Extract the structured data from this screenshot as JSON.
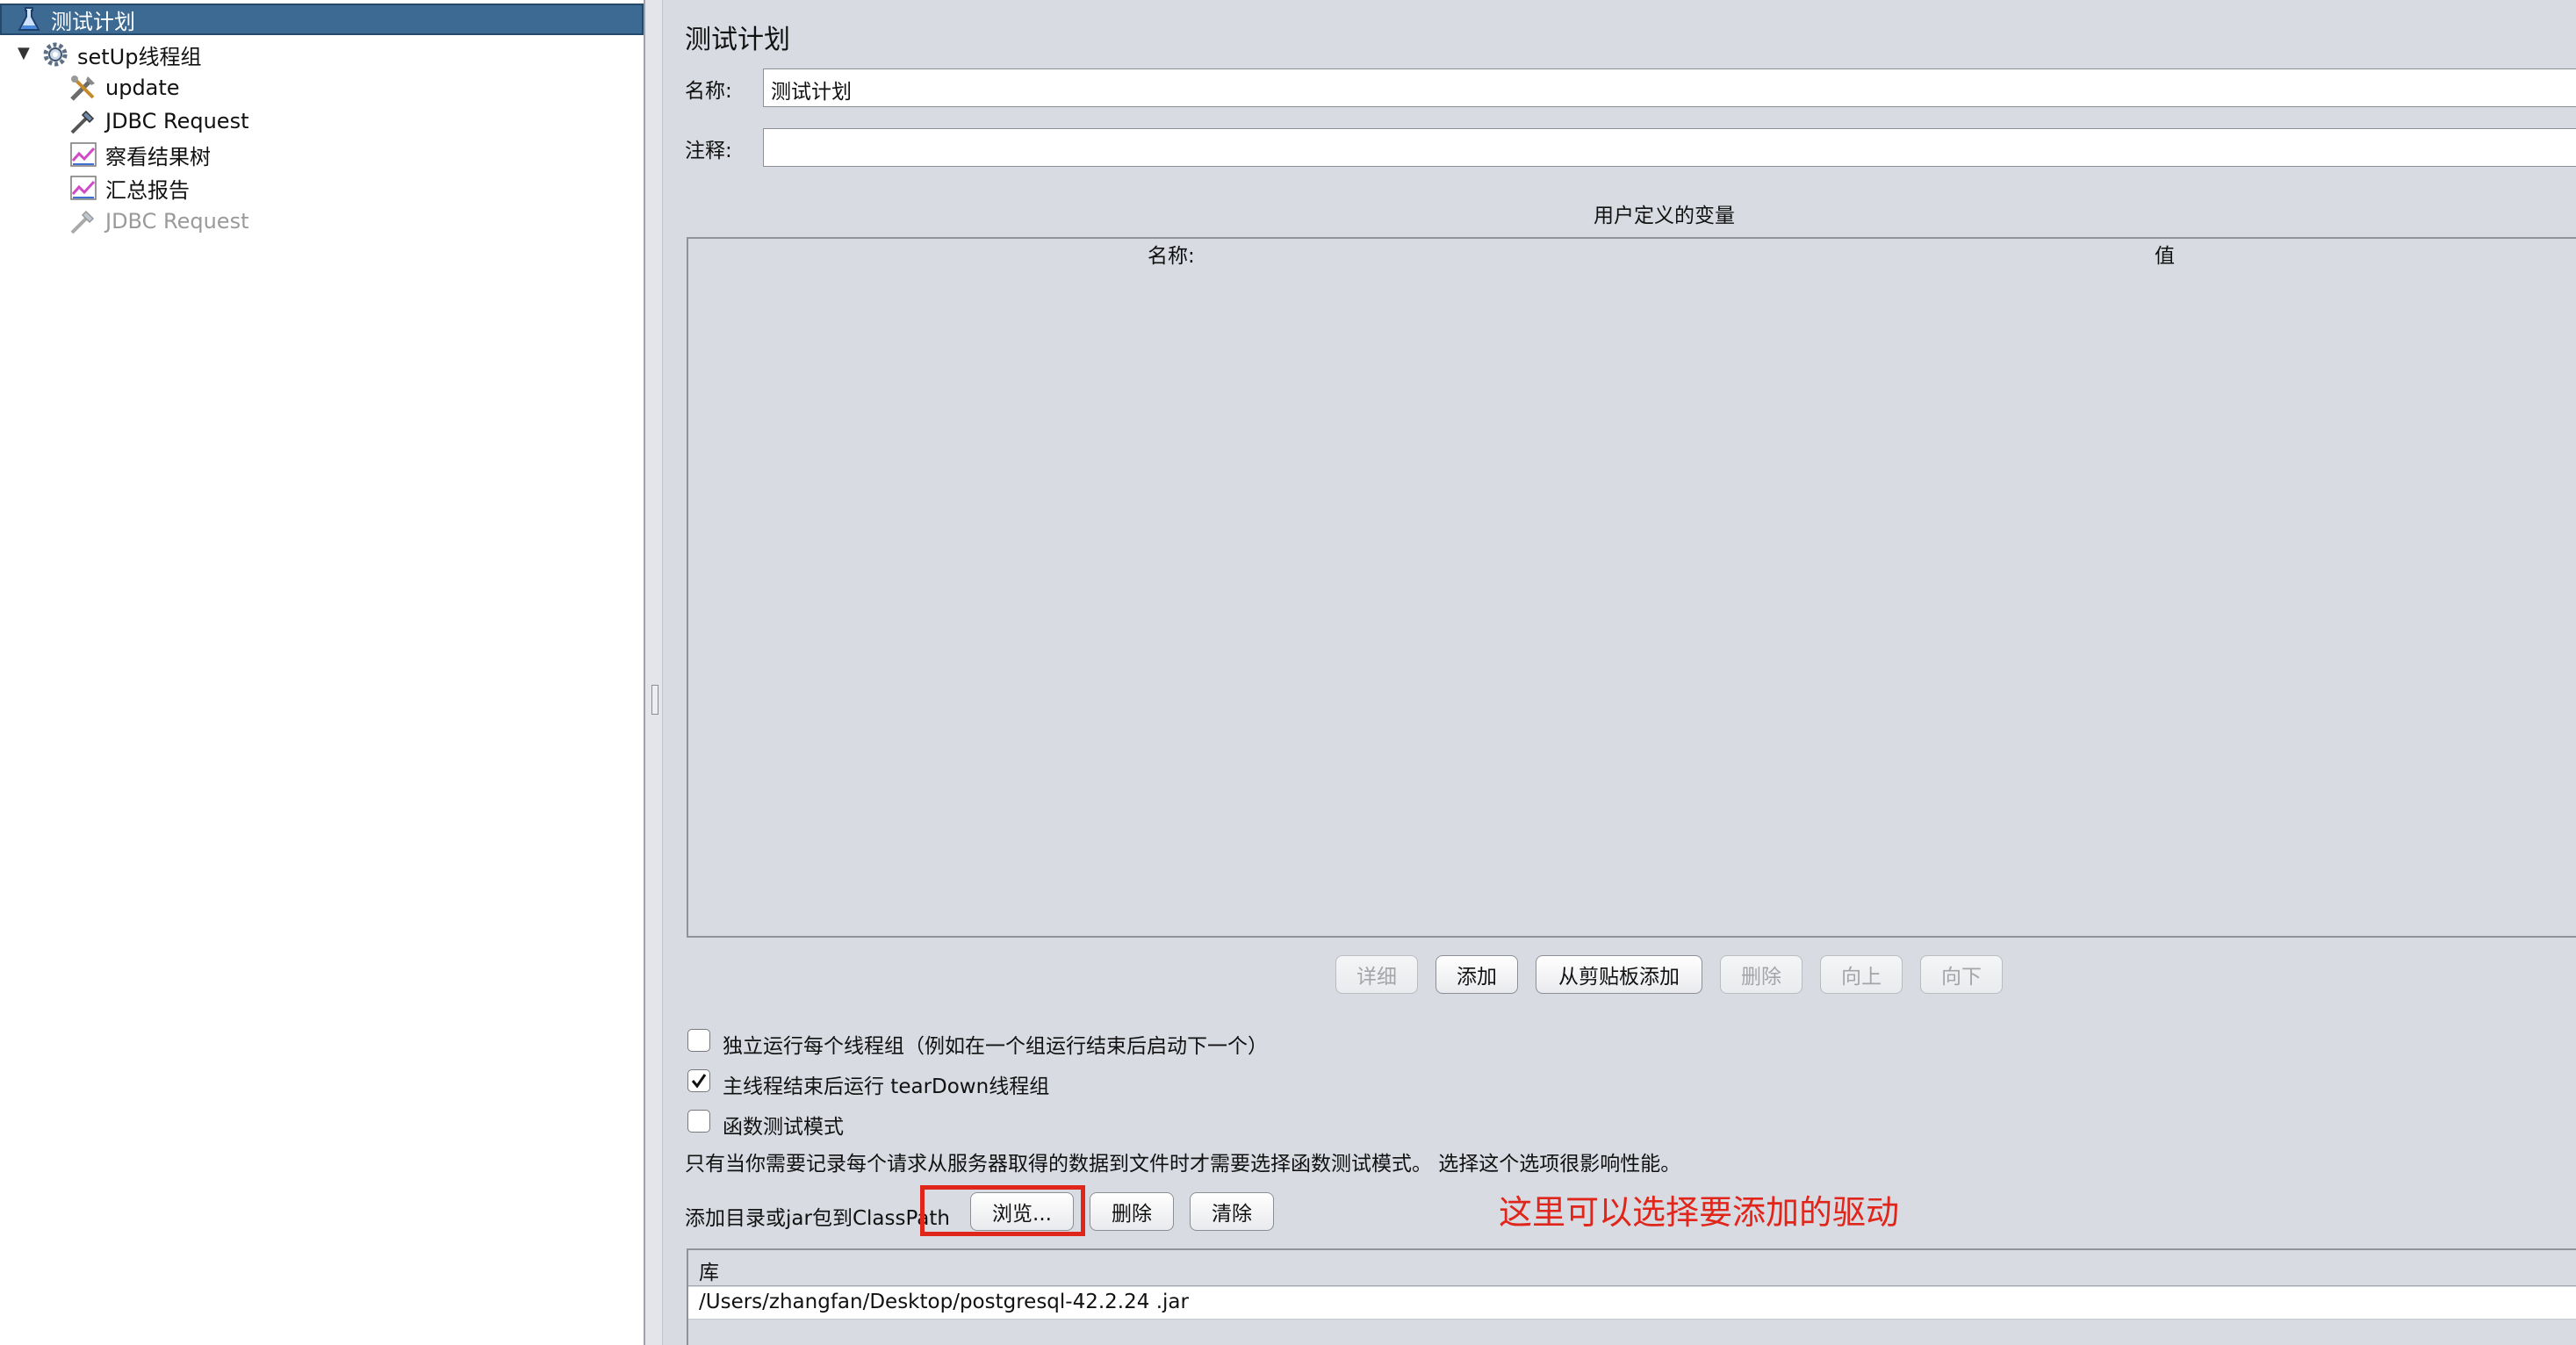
{
  "tree": {
    "root": "测试计划",
    "group": "setUp线程组",
    "items": [
      "update",
      "JDBC Request",
      "察看结果树",
      "汇总报告",
      "JDBC Request"
    ]
  },
  "panel": {
    "title": "测试计划",
    "name_label": "名称:",
    "name_value": "测试计划",
    "comment_label": "注释:",
    "comment_value": "",
    "vars_title": "用户定义的变量",
    "col_name": "名称:",
    "col_value": "值",
    "buttons": {
      "detail": "详细",
      "add": "添加",
      "add_clipboard": "从剪贴板添加",
      "delete": "删除",
      "up": "向上",
      "down": "向下"
    },
    "options": {
      "serial": "独立运行每个线程组（例如在一个组运行结束后启动下一个）",
      "teardown": "主线程结束后运行 tearDown线程组",
      "functional": "函数测试模式"
    },
    "functional_note": "只有当你需要记录每个请求从服务器取得的数据到文件时才需要选择函数测试模式。 选择这个选项很影响性能。",
    "classpath_label": "添加目录或jar包到ClassPath",
    "browse": "浏览...",
    "delete2": "删除",
    "clear": "清除",
    "annotation": "这里可以选择要添加的驱动",
    "lib_header": "库",
    "lib_row": "/Users/zhangfan/Desktop/postgresql-42.2.24 .jar"
  },
  "colors": {
    "selection": "#3d6a93",
    "annotation": "#e0251b"
  }
}
